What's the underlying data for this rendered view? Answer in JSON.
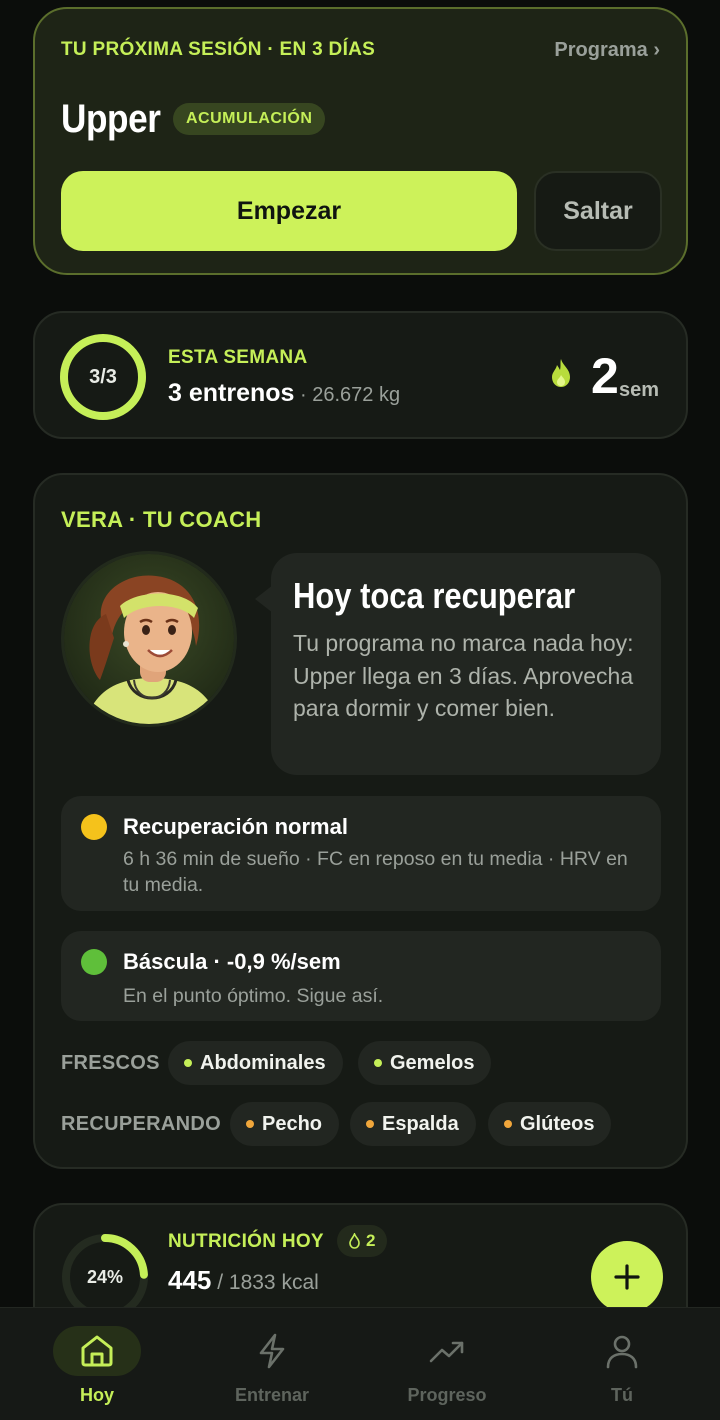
{
  "next_session": {
    "label": "TU PRÓXIMA SESIÓN · EN 3 DÍAS",
    "program_link": "Programa ›",
    "title": "Upper",
    "phase": "ACUMULACIÓN",
    "start_label": "Empezar",
    "skip_label": "Saltar"
  },
  "week": {
    "progress": "3/3",
    "progress_fraction": 1.0,
    "label": "ESTA SEMANA",
    "workouts": "3 entrenos",
    "volume": " · 26.672 kg",
    "streak_value": "2",
    "streak_unit": "sem",
    "streak_icon": "flame-icon"
  },
  "coach": {
    "label": "VERA · TU COACH",
    "headline": "Hoy toca recuperar",
    "message": "Tu programa no marca nada hoy: Upper llega en 3 días. Aprovecha para dormir y comer bien.",
    "recovery": {
      "title": "Recuperación normal",
      "detail": "6 h 36 min de sueño · FC en reposo en tu media · HRV en tu media.",
      "color": "#f5c21b"
    },
    "scale": {
      "title": "Báscula · -0,9 %/sem",
      "detail": "En el punto óptimo. Sigue así.",
      "color": "#5fbf3a"
    },
    "fresh_label": "FRESCOS",
    "fresh": [
      "Abdominales",
      "Gemelos"
    ],
    "recovering_label": "RECUPERANDO",
    "recovering": [
      "Pecho",
      "Espalda",
      "Glúteos"
    ],
    "fresh_color": "#c5ef58",
    "recovering_color": "#f0a63b"
  },
  "nutrition": {
    "percent": "24%",
    "percent_fraction": 0.24,
    "label": "NUTRICIÓN HOY",
    "badge_count": "2",
    "kcal": "445",
    "kcal_goal": " / 1833 kcal"
  },
  "nav": {
    "items": [
      {
        "label": "Hoy",
        "icon": "home-icon",
        "active": true
      },
      {
        "label": "Entrenar",
        "icon": "lightning-icon",
        "active": false
      },
      {
        "label": "Progreso",
        "icon": "trend-up-icon",
        "active": false
      },
      {
        "label": "Tú",
        "icon": "user-icon",
        "active": false
      }
    ]
  },
  "colors": {
    "accent": "#c5ef58",
    "background": "#0b0d0b",
    "card": "#161a15"
  }
}
